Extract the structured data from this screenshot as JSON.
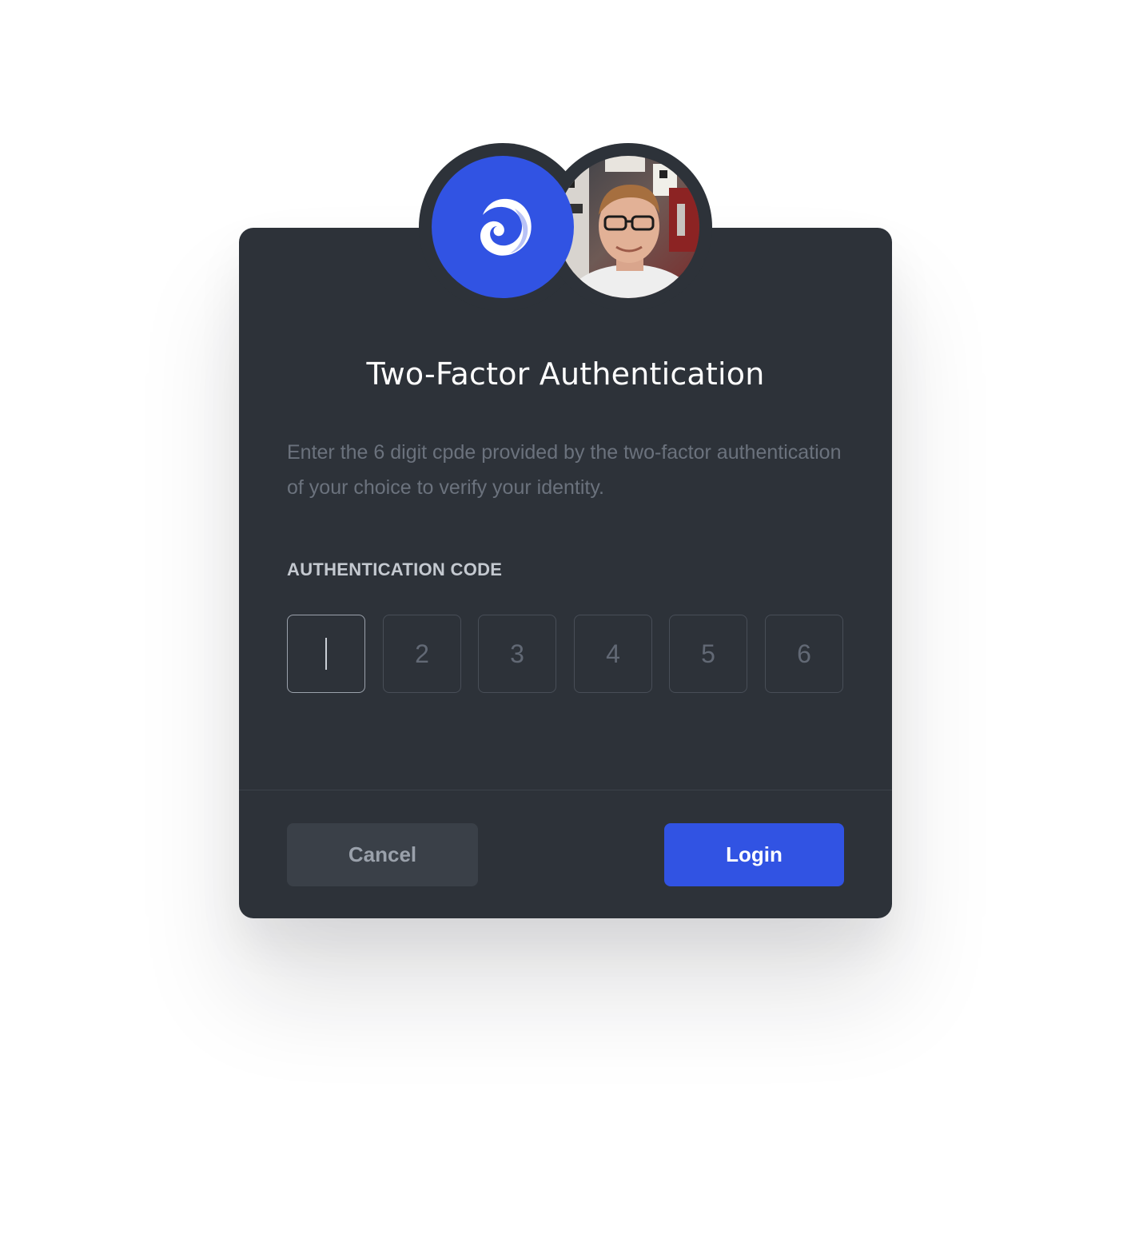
{
  "dialog": {
    "title": "Two-Factor Authentication",
    "description": "Enter the 6 digit cpde provided by the two-factor authentication of your choice to verify your identity.",
    "code_label": "AUTHENTICATION CODE",
    "code_fields": [
      {
        "placeholder": "",
        "active": true
      },
      {
        "placeholder": "2"
      },
      {
        "placeholder": "3"
      },
      {
        "placeholder": "4"
      },
      {
        "placeholder": "5"
      },
      {
        "placeholder": "6"
      }
    ],
    "cancel_label": "Cancel",
    "login_label": "Login"
  },
  "colors": {
    "card_bg": "#2d3239",
    "accent": "#3153e3",
    "title": "#ffffff",
    "description": "#6b727d",
    "label": "#c4c9d0"
  },
  "icons": {
    "logo": "app-logo-icon",
    "avatar": "user-avatar"
  }
}
